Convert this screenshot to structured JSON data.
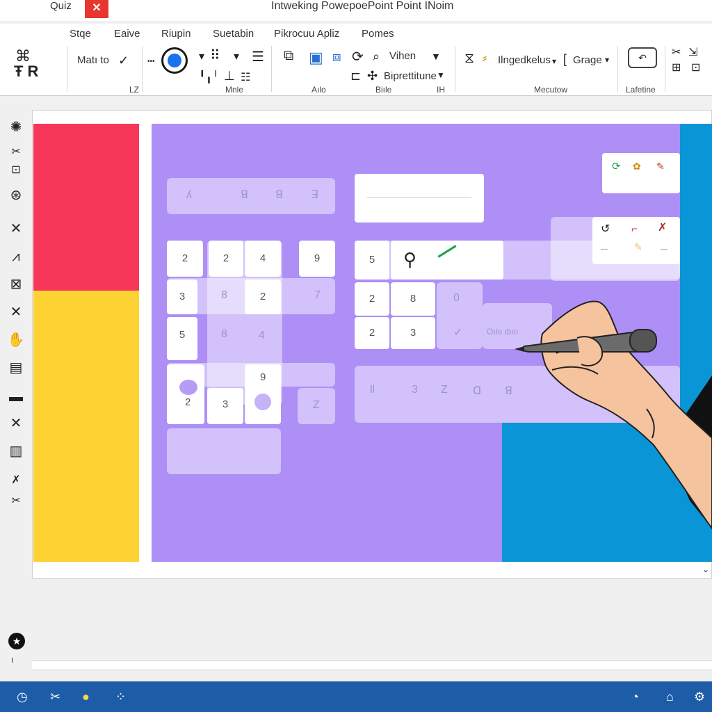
{
  "window": {
    "quiz_label": "Quiz",
    "close_glyph": "✕",
    "title": "Intweking PowepoePoint Point INoim"
  },
  "tabs": [
    "Stqe",
    "Eaive",
    "Riupin",
    "Suetabin",
    "Pikrocuu Apliz",
    "Pomes"
  ],
  "ribbon": {
    "text_math": "Matı to",
    "dropdown_1": "Vihen",
    "dropdown_2": "Biprettitune",
    "dropdown_3": "Ilngedkelus",
    "dropdown_4": "Grage",
    "group_labels": [
      "LZ",
      "Mnle",
      "Aılo",
      "Biıle",
      "IH",
      "Mecutow",
      "Lafetine"
    ]
  },
  "slide": {
    "left_grid": [
      "2",
      "2",
      "4",
      "9",
      "3",
      "2",
      "5",
      "9",
      "2",
      "3"
    ],
    "right_grid": [
      "5",
      "2",
      "8",
      "2",
      "3"
    ],
    "ghost_top": [
      "ʎ",
      "ꓭ",
      "ꓭ",
      "ꓱ"
    ],
    "ghost_left_faint": [
      "7",
      "8",
      "4",
      "Z"
    ],
    "ghost_mid_faint": [
      "0",
      "Oılo ıbııı"
    ],
    "ghost_bottom": [
      "ll",
      "3",
      "Z",
      "ꓷ",
      "ꓭ"
    ],
    "popup_icons": [
      "refresh-icon",
      "palette-icon",
      "eraser-icon"
    ],
    "tool_icons": [
      "lasso-icon",
      "pen-icon",
      "cursor-icon",
      "highlighter-icon"
    ]
  },
  "colors": {
    "pink": "#f7375a",
    "yellow": "#fdd233",
    "purple": "#ad8ff6",
    "blue": "#0a96d6",
    "statusbar": "#1d5ca7",
    "close": "#e8362f"
  },
  "status_icons": [
    "clock-icon",
    "tools-icon",
    "bulb-icon",
    "grid-icon",
    "timer-icon",
    "home-icon",
    "settings-icon"
  ]
}
